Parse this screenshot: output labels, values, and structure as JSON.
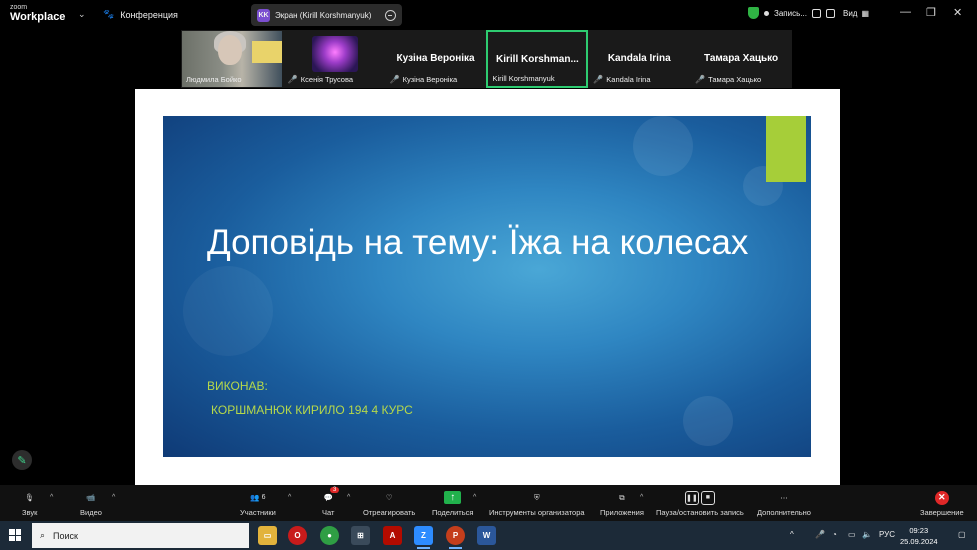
{
  "app": {
    "logo_small": "zoom",
    "logo_big": "Workplace",
    "conference_label": "Конференция",
    "screen_share_initials": "KK",
    "screen_share_label": "Экран (Kirill Korshmanyuk)",
    "recording_label": "Запись...",
    "view_label": "Вид"
  },
  "gallery": [
    {
      "name": "Людмила Бойко",
      "has_video": true,
      "muted": false
    },
    {
      "name": "Ксенія Трусова",
      "has_video": true,
      "muted": true
    },
    {
      "name": "Кузіна Вероніка",
      "display": "Кузіна Вероніка",
      "has_video": false,
      "muted": true
    },
    {
      "name": "Kirill Korshmanyuk",
      "display": "Kirill  Korshman...",
      "has_video": false,
      "muted": false,
      "active": true
    },
    {
      "name": "Kandala Irina",
      "display": "Kandala Irina",
      "has_video": false,
      "muted": true
    },
    {
      "name": "Тамара Хацько",
      "display": "Тамара Хацько",
      "has_video": false,
      "muted": true
    }
  ],
  "slide": {
    "title": "Доповідь на тему: Їжа на колесах",
    "author_label": "ВИКОНАВ:",
    "author_name": "КОРШМАНЮК КИРИЛО 194 4 КУРС",
    "accent_color": "#a6ce39"
  },
  "toolbar": {
    "audio": "Звук",
    "video": "Видео",
    "participants": "Участники",
    "participants_count": "6",
    "chat": "Чат",
    "chat_badge": "3",
    "react": "Отреагировать",
    "share": "Поделиться",
    "host_tools": "Инструменты организатора",
    "apps": "Приложения",
    "pause_record": "Пауза/остановить запись",
    "more": "Дополнительно",
    "end": "Завершение"
  },
  "taskbar": {
    "search_label": "Поиск",
    "language": "РУС",
    "time": "09:23",
    "date": "25.09.2024"
  },
  "colors": {
    "active_border": "#2ecc71",
    "share_green": "#21b14c",
    "end_red": "#e02828"
  }
}
